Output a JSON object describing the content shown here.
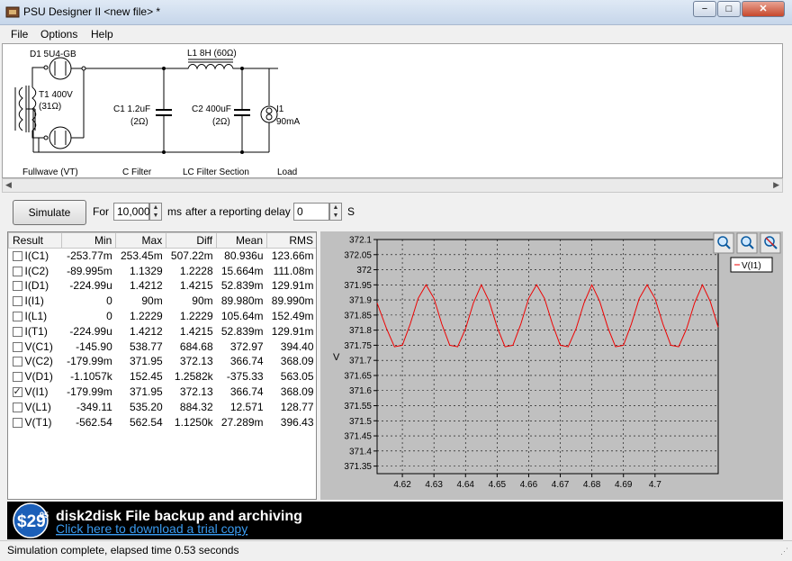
{
  "window": {
    "title": "PSU Designer II  <new file> *",
    "min_glyph": "−",
    "max_glyph": "□",
    "close_glyph": "✕"
  },
  "menu": [
    "File",
    "Options",
    "Help"
  ],
  "schematic": {
    "labels": {
      "d1": "D1 5U4-GB",
      "t1": "T1 400V",
      "t1r": "(31Ω)",
      "l1": "L1 8H (60Ω)",
      "c1": "C1 1.2uF",
      "c1r": "(2Ω)",
      "c2": "C2 400uF",
      "c2r": "(2Ω)",
      "i1": "I1",
      "i1v": "90mA"
    },
    "sections": [
      "Fullwave (VT)",
      "C Filter",
      "LC Filter Section",
      "Load"
    ]
  },
  "sim": {
    "simulate_label": "Simulate",
    "for_label": "For",
    "duration": "10,000",
    "ms_label": "ms",
    "delay_label": "after a reporting delay of",
    "delay": "0",
    "s_label": "S"
  },
  "results": {
    "headers": [
      "Result",
      "Min",
      "Max",
      "Diff",
      "Mean",
      "RMS"
    ],
    "rows": [
      {
        "name": "I(C1)",
        "checked": false,
        "min": "-253.77m",
        "max": "253.45m",
        "diff": "507.22m",
        "mean": "80.936u",
        "rms": "123.66m"
      },
      {
        "name": "I(C2)",
        "checked": false,
        "min": "-89.995m",
        "max": "1.1329",
        "diff": "1.2228",
        "mean": "15.664m",
        "rms": "111.08m"
      },
      {
        "name": "I(D1)",
        "checked": false,
        "min": "-224.99u",
        "max": "1.4212",
        "diff": "1.4215",
        "mean": "52.839m",
        "rms": "129.91m"
      },
      {
        "name": "I(I1)",
        "checked": false,
        "min": "0",
        "max": "90m",
        "diff": "90m",
        "mean": "89.980m",
        "rms": "89.990m"
      },
      {
        "name": "I(L1)",
        "checked": false,
        "min": "0",
        "max": "1.2229",
        "diff": "1.2229",
        "mean": "105.64m",
        "rms": "152.49m"
      },
      {
        "name": "I(T1)",
        "checked": false,
        "min": "-224.99u",
        "max": "1.4212",
        "diff": "1.4215",
        "mean": "52.839m",
        "rms": "129.91m"
      },
      {
        "name": "V(C1)",
        "checked": false,
        "min": "-145.90",
        "max": "538.77",
        "diff": "684.68",
        "mean": "372.97",
        "rms": "394.40"
      },
      {
        "name": "V(C2)",
        "checked": false,
        "min": "-179.99m",
        "max": "371.95",
        "diff": "372.13",
        "mean": "366.74",
        "rms": "368.09"
      },
      {
        "name": "V(D1)",
        "checked": false,
        "min": "-1.1057k",
        "max": "152.45",
        "diff": "1.2582k",
        "mean": "-375.33",
        "rms": "563.05"
      },
      {
        "name": "V(I1)",
        "checked": true,
        "min": "-179.99m",
        "max": "371.95",
        "diff": "372.13",
        "mean": "366.74",
        "rms": "368.09"
      },
      {
        "name": "V(L1)",
        "checked": false,
        "min": "-349.11",
        "max": "535.20",
        "diff": "884.32",
        "mean": "12.571",
        "rms": "128.77"
      },
      {
        "name": "V(T1)",
        "checked": false,
        "min": "-562.54",
        "max": "562.54",
        "diff": "1.1250k",
        "mean": "27.289m",
        "rms": "396.43"
      }
    ]
  },
  "chart_data": {
    "type": "line",
    "ylabel": "V",
    "xlim": [
      4.612,
      4.72
    ],
    "ylim": [
      371.325,
      372.1
    ],
    "x_ticks": [
      4.62,
      4.63,
      4.64,
      4.65,
      4.66,
      4.67,
      4.68,
      4.69,
      4.7
    ],
    "x_tick_labels": [
      "4.62",
      "4.63",
      "4.64",
      "4.65",
      "4.66",
      "4.67",
      "4.68",
      "4.69",
      "4.7"
    ],
    "y_ticks": [
      372.1,
      372.05,
      372,
      371.95,
      371.9,
      371.85,
      371.8,
      371.75,
      371.7,
      371.65,
      371.6,
      371.55,
      371.5,
      371.45,
      371.4,
      371.35
    ],
    "y_tick_labels": [
      "372.1",
      "372.05",
      "372",
      "371.95",
      "371.9",
      "371.85",
      "371.8",
      "371.75",
      "371.7",
      "371.65",
      "371.6",
      "371.55",
      "371.5",
      "371.45",
      "371.4",
      "371.35"
    ],
    "grid": true,
    "legend": "top-right",
    "series": [
      {
        "name": "V(I1)",
        "color": "#ee0000",
        "x": [
          4.612,
          4.615,
          4.6175,
          4.62,
          4.6225,
          4.625,
          4.6275,
          4.63,
          4.6325,
          4.635,
          4.6375,
          4.64,
          4.6425,
          4.645,
          4.6475,
          4.65,
          4.6525,
          4.655,
          4.6575,
          4.66,
          4.6625,
          4.665,
          4.6675,
          4.67,
          4.6725,
          4.675,
          4.6775,
          4.68,
          4.6825,
          4.685,
          4.6875,
          4.69,
          4.6925,
          4.695,
          4.6975,
          4.7,
          4.7025,
          4.705,
          4.7075,
          4.71,
          4.7125,
          4.715,
          4.7175,
          4.72
        ],
        "y": [
          371.89,
          371.805,
          371.745,
          371.75,
          371.82,
          371.905,
          371.95,
          371.905,
          371.82,
          371.75,
          371.745,
          371.805,
          371.89,
          371.95,
          371.895,
          371.81,
          371.745,
          371.75,
          371.82,
          371.905,
          371.95,
          371.905,
          371.82,
          371.75,
          371.745,
          371.805,
          371.89,
          371.95,
          371.895,
          371.81,
          371.745,
          371.75,
          371.82,
          371.905,
          371.95,
          371.905,
          371.82,
          371.75,
          371.745,
          371.805,
          371.89,
          371.95,
          371.895,
          371.81
        ]
      }
    ]
  },
  "chart_tools": [
    "zoom-in-icon",
    "zoom-out-icon",
    "zoom-reset-icon"
  ],
  "ad": {
    "price_main": "$29",
    "price_cents": "95",
    "title": "disk2disk File backup and archiving",
    "link": "Click here to download a trial copy"
  },
  "status": "Simulation complete, elapsed time 0.53 seconds",
  "colors": {
    "accent_link": "#3a9bf0",
    "trace": "#ee0000",
    "chart_bg": "#c0c0c0"
  }
}
